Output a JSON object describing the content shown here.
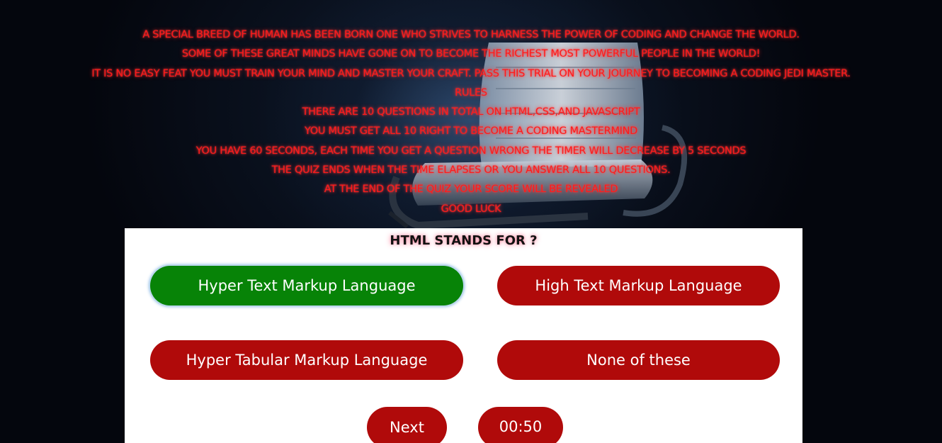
{
  "intro": {
    "lines": [
      "A SPECIAL BREED OF HUMAN HAS BEEN BORN ONE WHO STRIVES TO HARNESS THE POWER OF CODING AND CHANGE THE WORLD.",
      "SOME OF THESE GREAT MINDS HAVE GONE ON TO BECOME THE RICHEST MOST POWERFUL PEOPLE IN THE WORLD!",
      "IT IS NO EASY FEAT YOU MUST TRAIN YOUR MIND AND MASTER YOUR CRAFT. PASS THIS TRIAL ON YOUR JOURNEY TO BECOMING A CODING JEDI MASTER.",
      "RULES",
      "THERE ARE 10 QUESTIONS IN TOTAL ON HTML,CSS,AND JAVASCRIPT",
      "YOU MUST GET ALL 10 RIGHT TO BECOME A CODING MASTERMIND",
      "YOU HAVE 60 SECONDS, EACH TIME YOU GET A QUESTION WRONG THE TIMER WILL DECREASE BY 5 SECONDS",
      "THE QUIZ ENDS WHEN THE TIME ELAPSES OR YOU ANSWER ALL 10 QUESTIONS.",
      "AT THE END OF THE QUIZ YOUR SCORE WILL BE REVEALED",
      "GOOD LUCK"
    ]
  },
  "quiz": {
    "question": "HTML STANDS FOR ?",
    "answers": [
      {
        "label": "Hyper Text Markup Language",
        "state": "correct"
      },
      {
        "label": "High Text Markup Language",
        "state": "wrong"
      },
      {
        "label": "Hyper Tabular Markup Language",
        "state": "wrong"
      },
      {
        "label": "None of these",
        "state": "wrong"
      }
    ],
    "next_label": "Next",
    "timer": "00:50"
  },
  "colors": {
    "intro_text": "#ff1a1a",
    "answer_wrong": "#b00a0a",
    "answer_correct": "#078307",
    "card_background": "#ffffff",
    "page_background": "#04060d"
  }
}
